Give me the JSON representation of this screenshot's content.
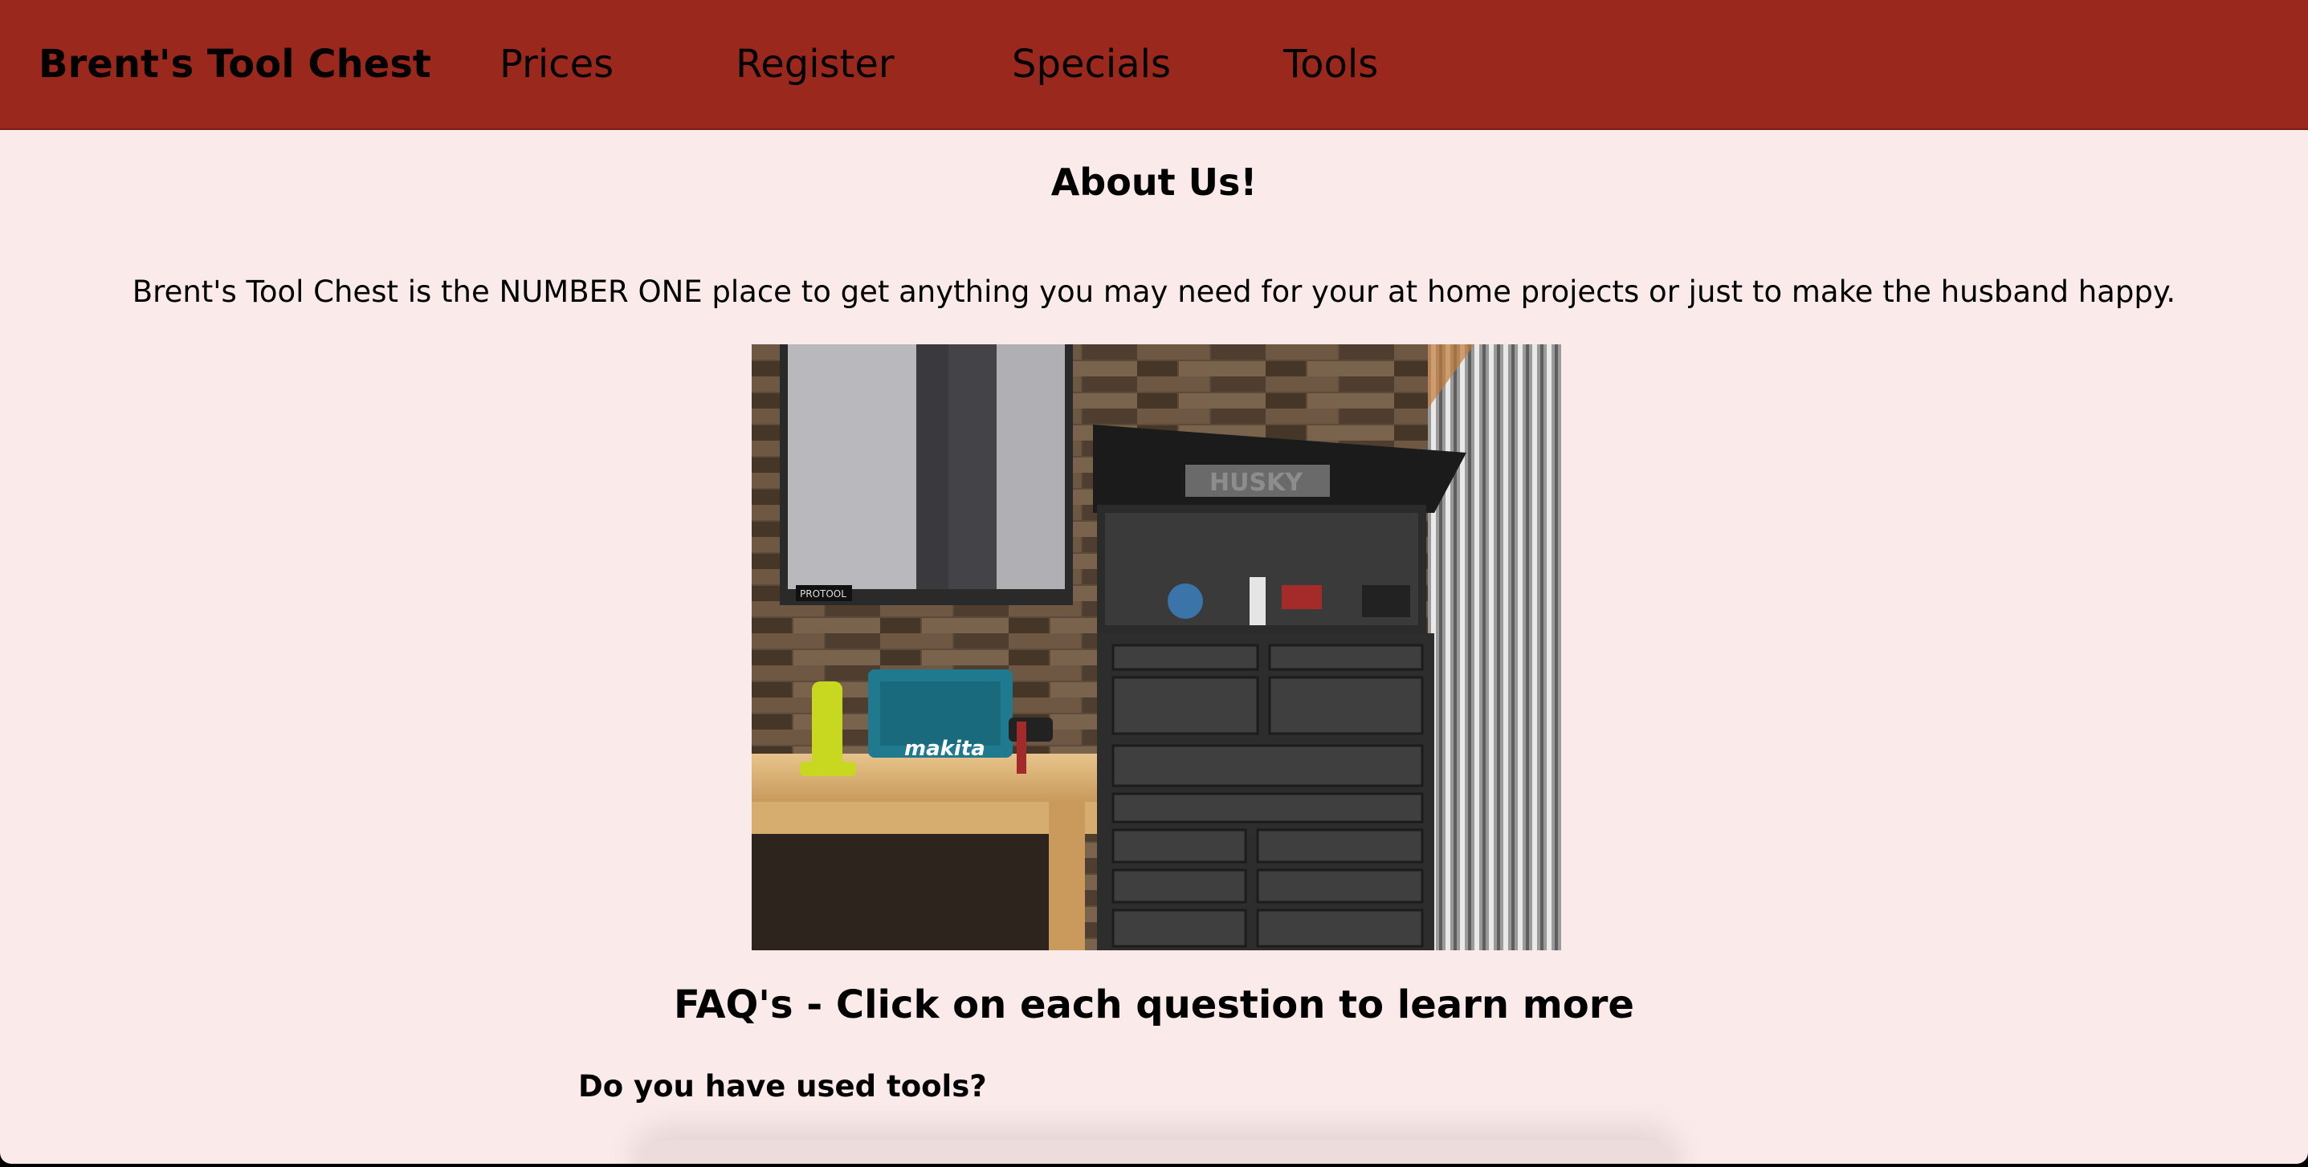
{
  "navbar": {
    "brand": "Brent's Tool Chest",
    "links": [
      {
        "label": "Prices"
      },
      {
        "label": "Register"
      },
      {
        "label": "Specials"
      },
      {
        "label": "Tools"
      }
    ]
  },
  "about": {
    "title": "About Us!",
    "text": "Brent's Tool Chest is the NUMBER ONE place to get anything you may need for your at home projects or just to make the husband happy."
  },
  "hero_image": {
    "icon": "tool-chest-photo",
    "box_text": "makita",
    "chest_text": "HUSKY"
  },
  "faq": {
    "title": "FAQ's - Click on each question to learn more",
    "questions": [
      {
        "question": "Do you have used tools?"
      }
    ]
  },
  "colors": {
    "nav_bg": "#9b281c",
    "page_bg": "#fbeaea"
  }
}
